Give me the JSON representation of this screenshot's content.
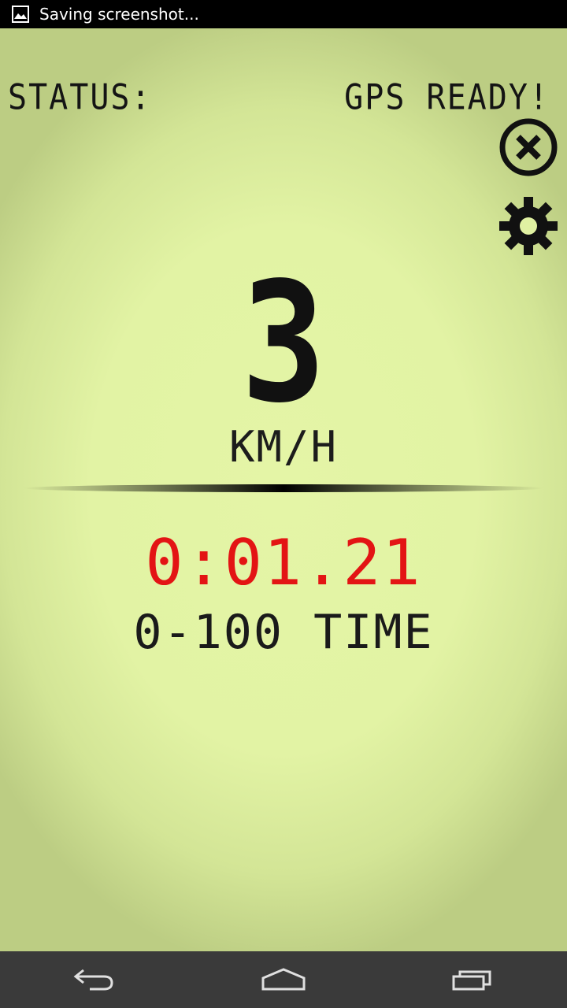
{
  "status_bar": {
    "notification_icon": "picture-icon",
    "notification_text": "Saving screenshot..."
  },
  "header": {
    "status_label": "STATUS:",
    "status_value": "GPS READY!"
  },
  "toolbar": {
    "close_icon": "close-circle-icon",
    "settings_icon": "gear-icon"
  },
  "speedometer": {
    "speed": "3",
    "unit": "KM/H"
  },
  "timer": {
    "value": "0:01.21",
    "label": "0-100 TIME"
  },
  "navigation": {
    "back_icon": "back-icon",
    "home_icon": "home-icon",
    "recents_icon": "recents-icon"
  },
  "colors": {
    "lcd_background": "#e2f3a4",
    "lcd_text": "#141414",
    "timer_text": "#e31414",
    "nav_background": "#3a3a3a"
  }
}
